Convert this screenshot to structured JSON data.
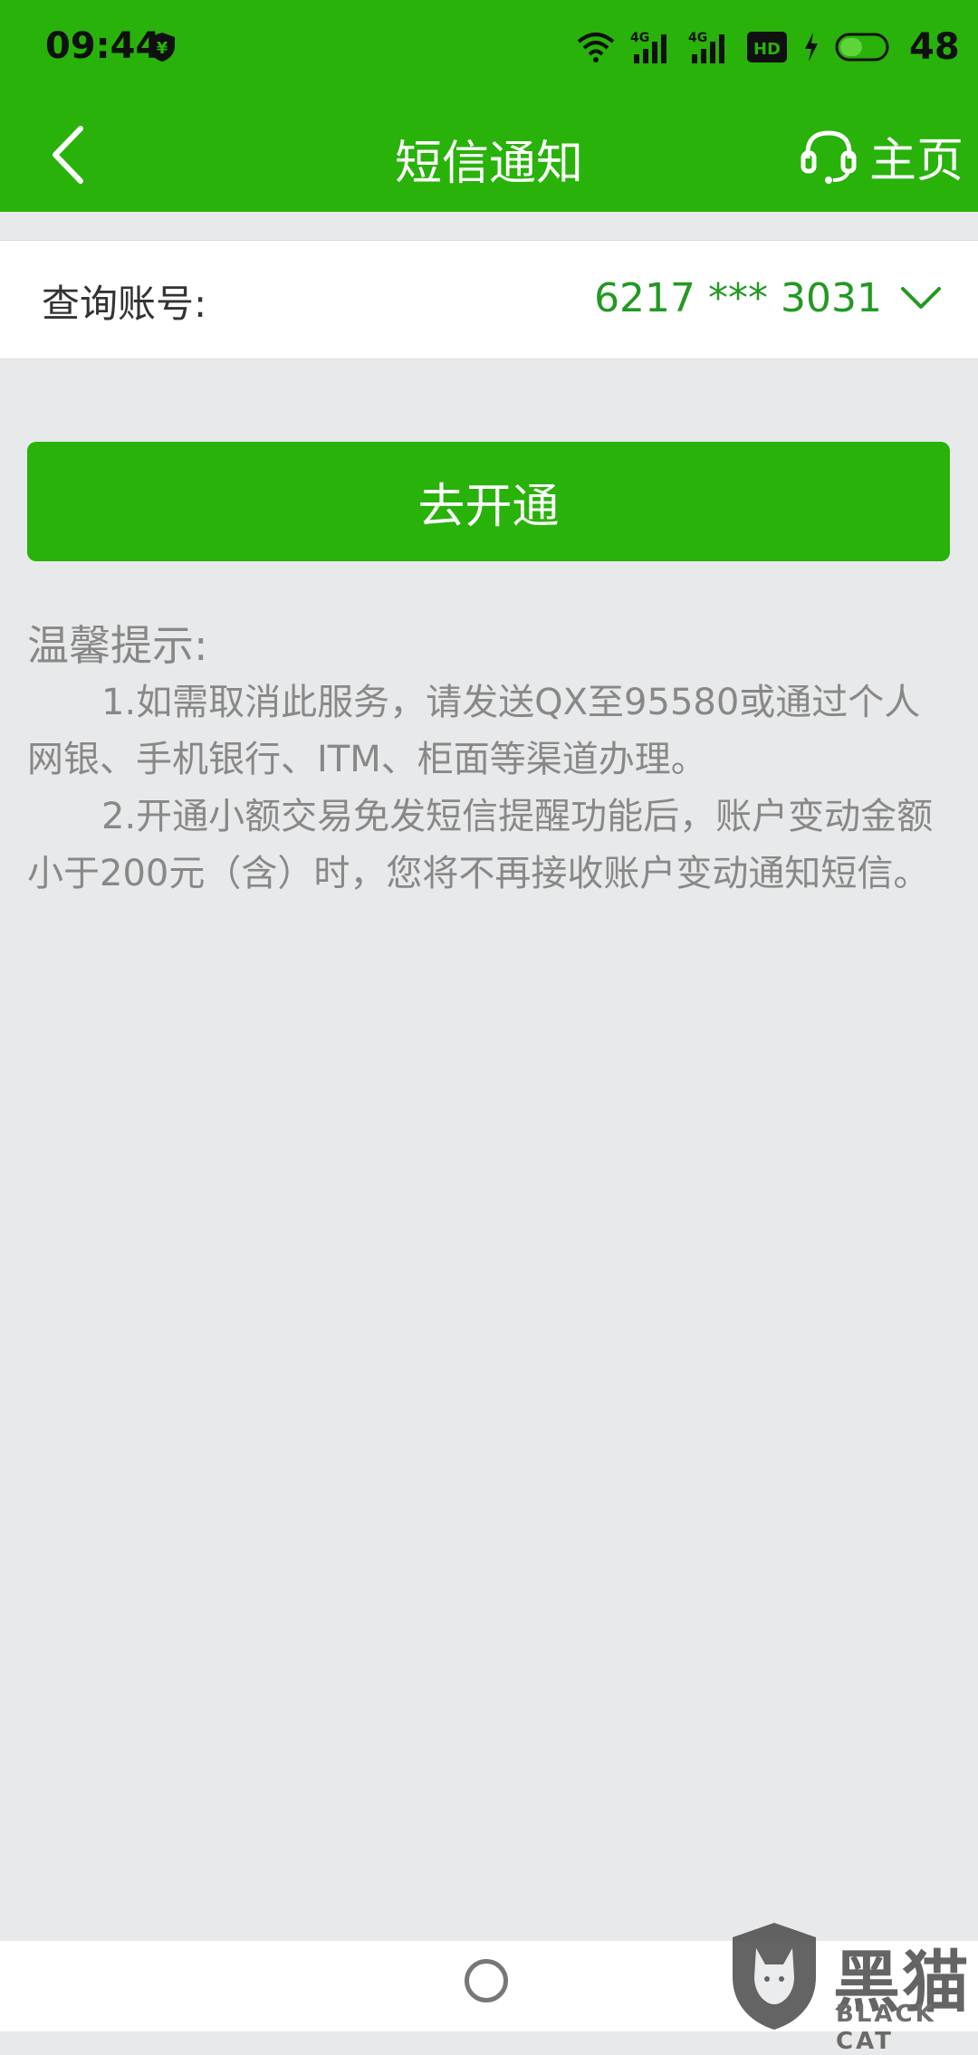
{
  "status_bar": {
    "time": "09:44",
    "network_1": "4G",
    "network_2": "4G",
    "hd_badge": "HD",
    "battery": "48",
    "icons": [
      "shield-yuan-icon",
      "wifi-icon",
      "signal-icon",
      "signal-icon",
      "hd-icon",
      "charging-icon",
      "battery-icon"
    ]
  },
  "header": {
    "title": "短信通知",
    "home_label": "主页",
    "icons": [
      "back-arrow-icon",
      "headset-icon"
    ]
  },
  "account": {
    "label": "查询账号:",
    "value": "6217 *** 3031"
  },
  "primary_button": {
    "label": "去开通"
  },
  "tips": {
    "title": "温馨提示:",
    "items": [
      "1.如需取消此服务，请发送QX至95580或通过个人网银、手机银行、ITM、柜面等渠道办理。",
      "2.开通小额交易免发短信提醒功能后，账户变动金额小于200元（含）时，您将不再接收账户变动通知短信。"
    ]
  },
  "watermark": {
    "name": "黑猫",
    "sub": "BLACK CAT"
  },
  "colors": {
    "brand_green": "#28b20a",
    "account_green": "#229922",
    "background": "#e8e9ea",
    "tip_text": "#888888"
  }
}
